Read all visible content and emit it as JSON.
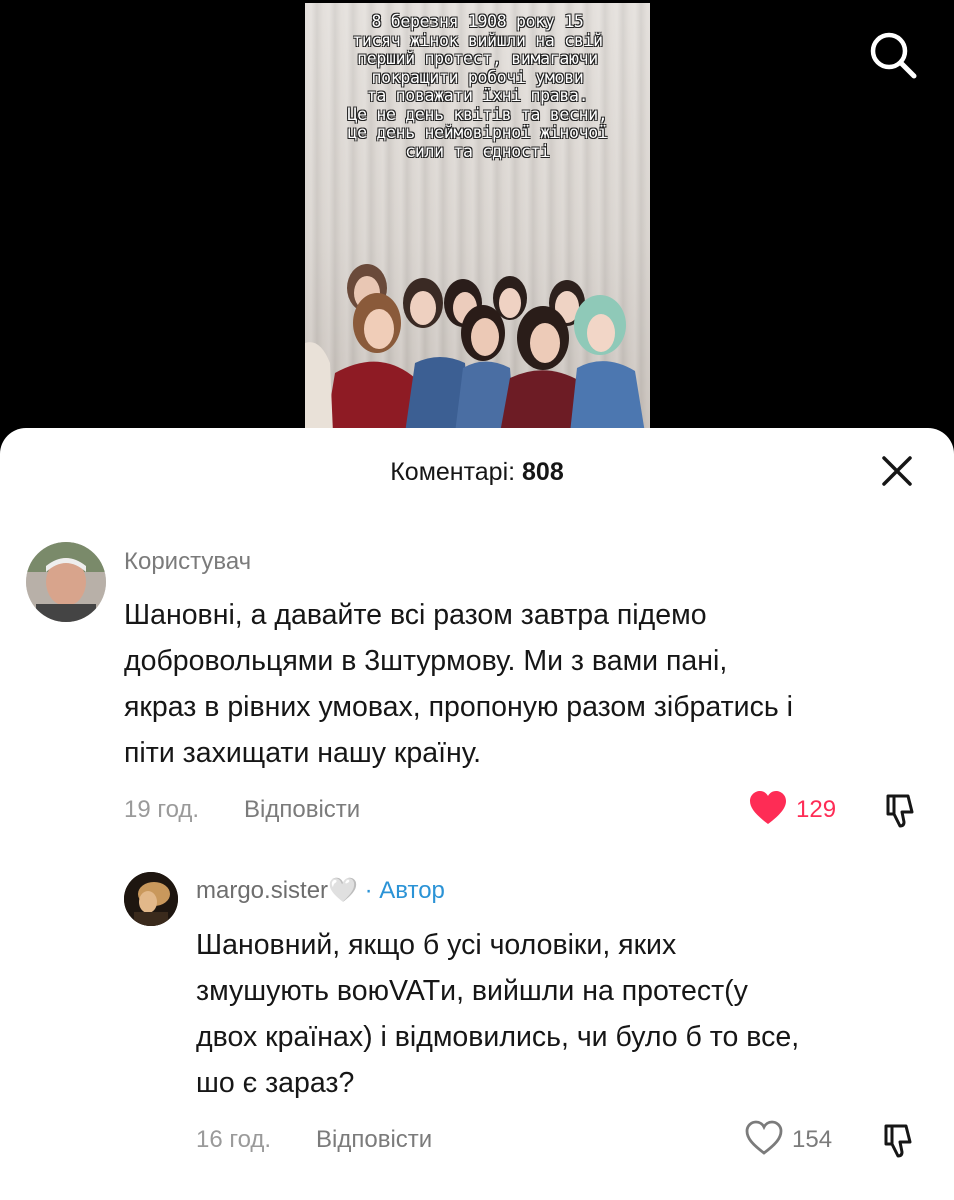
{
  "video": {
    "overlay_text": "8 березня 1908 року 15\nтисяч жінок вийшли на свій\nперший протест, вимагаючи\nпокращити робочі умови\nта поважати їхні права.\nЦе не день квітів та весни,\nце день неймовірної жіночої\nсили та єдності"
  },
  "header": {
    "search_icon": "search-icon"
  },
  "comments_sheet": {
    "title_label": "Коментарі:",
    "title_count": "808",
    "close_icon": "close-icon"
  },
  "comments": [
    {
      "username": "Користувач",
      "lines": [
        "Шановні, а давайте всі разом завтра підемо",
        "добровольцями в 3штурмову. Ми з вами пані,",
        "якраз в рівних умовах, пропоную разом зібратись і",
        "піти захищати нашу країну."
      ],
      "time": "19 год.",
      "reply_label": "Відповісти",
      "likes": "129",
      "liked": true,
      "like_color": "#fe2c55"
    },
    {
      "username": "margo.sister🤍",
      "badge": "· Автор",
      "lines": [
        "Шановний, якщо б усі чоловіки, яких",
        "змушують воюVATи, вийшли на протест(у",
        "двох країнах) і відмовились, чи було б то все,",
        "шо є зараз?"
      ],
      "time": "16 год.",
      "reply_label": "Відповісти",
      "likes": "154",
      "liked": false
    }
  ]
}
